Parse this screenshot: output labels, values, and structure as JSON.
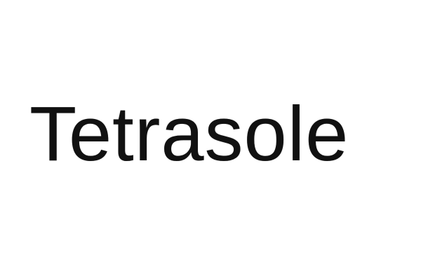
{
  "text": {
    "word": "Tetrasole"
  },
  "colors": {
    "background": "#ffffff",
    "text": "#111111"
  }
}
